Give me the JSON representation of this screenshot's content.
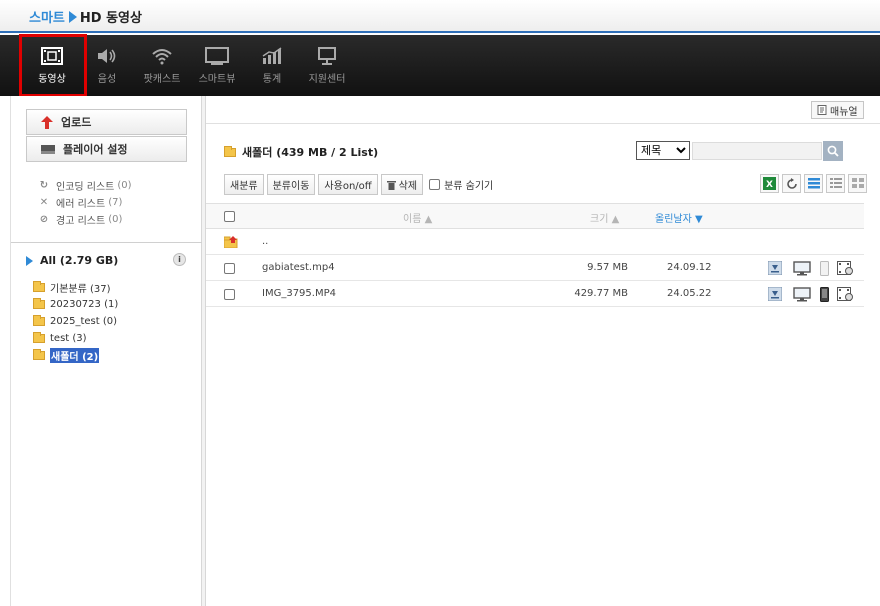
{
  "brand": {
    "part1": "스마트",
    "part2": "HD 동영상"
  },
  "nav": [
    {
      "label": "동영상",
      "icon": "film-icon",
      "active": true
    },
    {
      "label": "음성",
      "icon": "speaker-icon",
      "active": false
    },
    {
      "label": "팟캐스트",
      "icon": "wifi-icon",
      "active": false
    },
    {
      "label": "스마트뷰",
      "icon": "monitor-icon",
      "active": false
    },
    {
      "label": "통계",
      "icon": "bar-chart-icon",
      "active": false
    },
    {
      "label": "지원센터",
      "icon": "desktop-icon",
      "active": false
    }
  ],
  "left": {
    "upload_label": "업로드",
    "player_settings_label": "플레이어 설정",
    "status": [
      {
        "label": "인코딩 리스트",
        "count": "(0)",
        "icon": "refresh-icon"
      },
      {
        "label": "에러 리스트",
        "count": "(7)",
        "icon": "x-icon"
      },
      {
        "label": "경고 리스트",
        "count": "(0)",
        "icon": "no-icon"
      }
    ],
    "all_label": "All (2.79 GB)",
    "info_glyph": "i",
    "folders": [
      {
        "label": "기본분류 (37)",
        "selected": false
      },
      {
        "label": "20230723 (1)",
        "selected": false
      },
      {
        "label": "2025_test (0)",
        "selected": false
      },
      {
        "label": "test (3)",
        "selected": false
      },
      {
        "label": "새폴더 (2)",
        "selected": true
      }
    ]
  },
  "main": {
    "manual_label": "매뉴얼",
    "folder_title": "새폴더 (439 MB / 2 List)",
    "search": {
      "selected_option": "제목",
      "placeholder": ""
    },
    "toolbar": {
      "new_category": "새분류",
      "move_category": "분류이동",
      "use_toggle": "사용on/off",
      "delete": "삭제",
      "hide_category": "분류 숨기기"
    },
    "table": {
      "headers": {
        "name": "이름 ▲",
        "size": "크기 ▲",
        "date": "올린날자 ▼"
      },
      "parent_label": "..",
      "rows": [
        {
          "name": "gabiatest.mp4",
          "size": "9.57 MB",
          "date": "24.09.12"
        },
        {
          "name": "IMG_3795.MP4",
          "size": "429.77 MB",
          "date": "24.05.22"
        }
      ]
    },
    "colors": {
      "accent": "#2f8ad6",
      "highlight": "#e00000",
      "selected": "#3466c6"
    }
  }
}
